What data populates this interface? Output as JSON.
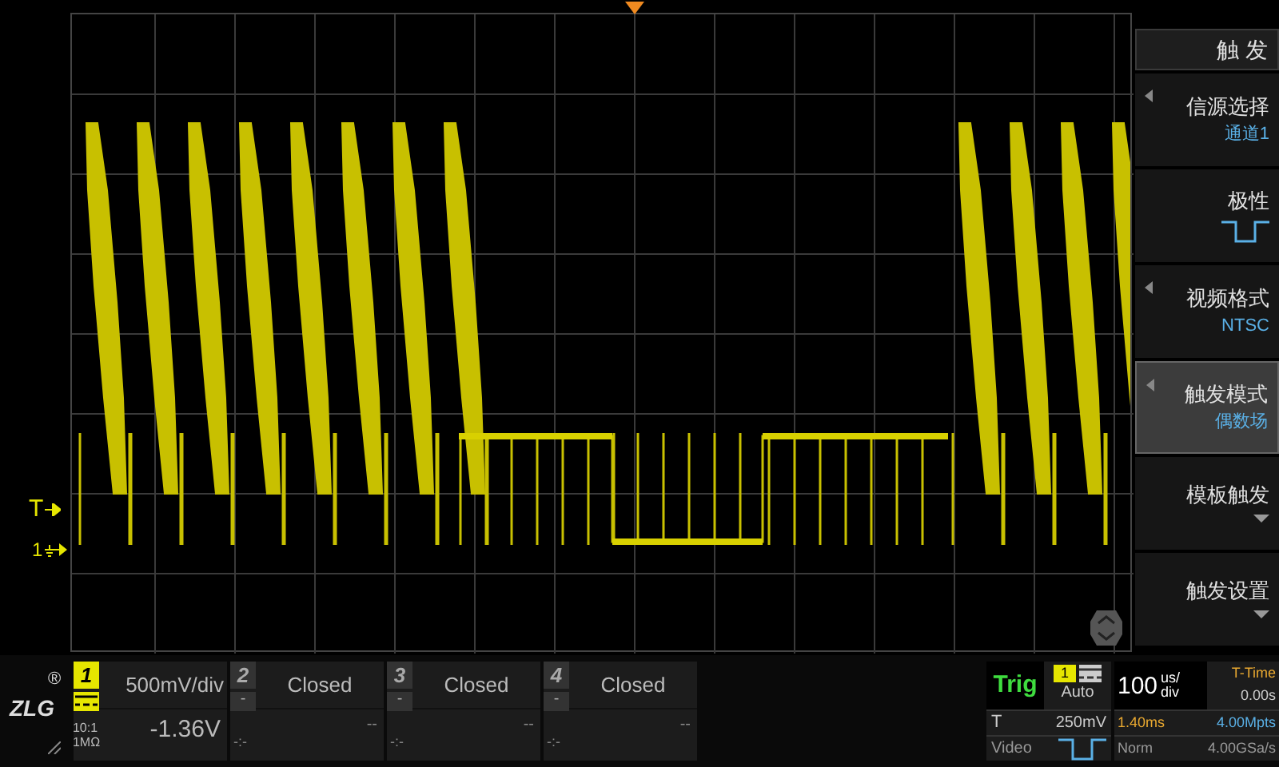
{
  "markers": {
    "trigger_level": "T",
    "channel_ground": "1"
  },
  "menu": {
    "title": "触 发",
    "items": [
      {
        "title": "信源选择",
        "kind": "text",
        "value": "通道1",
        "submenu": true,
        "selected": false
      },
      {
        "title": "极性",
        "kind": "polarity",
        "submenu": false,
        "selected": false
      },
      {
        "title": "视频格式",
        "kind": "text",
        "value": "NTSC",
        "submenu": true,
        "selected": false
      },
      {
        "title": "触发模式",
        "kind": "text",
        "value": "偶数场",
        "submenu": true,
        "selected": true
      },
      {
        "title": "模板触发",
        "kind": "dropdown",
        "submenu": false,
        "selected": false
      },
      {
        "title": "触发设置",
        "kind": "dropdown",
        "submenu": false,
        "selected": false
      }
    ]
  },
  "logo": {
    "text": "ZLG",
    "mark": "®"
  },
  "channels": [
    {
      "number": "1",
      "on": true,
      "scale": "500mV/div",
      "offset": "-1.36V",
      "probe": "10:1",
      "impedance": "1MΩ"
    },
    {
      "number": "2",
      "on": false,
      "coupling": "-",
      "scale": "Closed",
      "offset": "--",
      "probe": "-:-"
    },
    {
      "number": "3",
      "on": false,
      "coupling": "-",
      "scale": "Closed",
      "offset": "--",
      "probe": "-:-"
    },
    {
      "number": "4",
      "on": false,
      "coupling": "-",
      "scale": "Closed",
      "offset": "--",
      "probe": "-:-"
    }
  ],
  "trigger": {
    "status": "Trig",
    "source": "1",
    "mode": "Auto",
    "type_label": "T",
    "level": "250mV",
    "type": "Video"
  },
  "timebase": {
    "value": "100",
    "unit_top": "us/",
    "unit_bottom": "div",
    "position_label": "T-Time",
    "position": "0.00s",
    "delay": "1.40ms",
    "memory": "4.00Mpts",
    "acquire": "Norm",
    "sample_rate": "4.00GSa/s"
  }
}
